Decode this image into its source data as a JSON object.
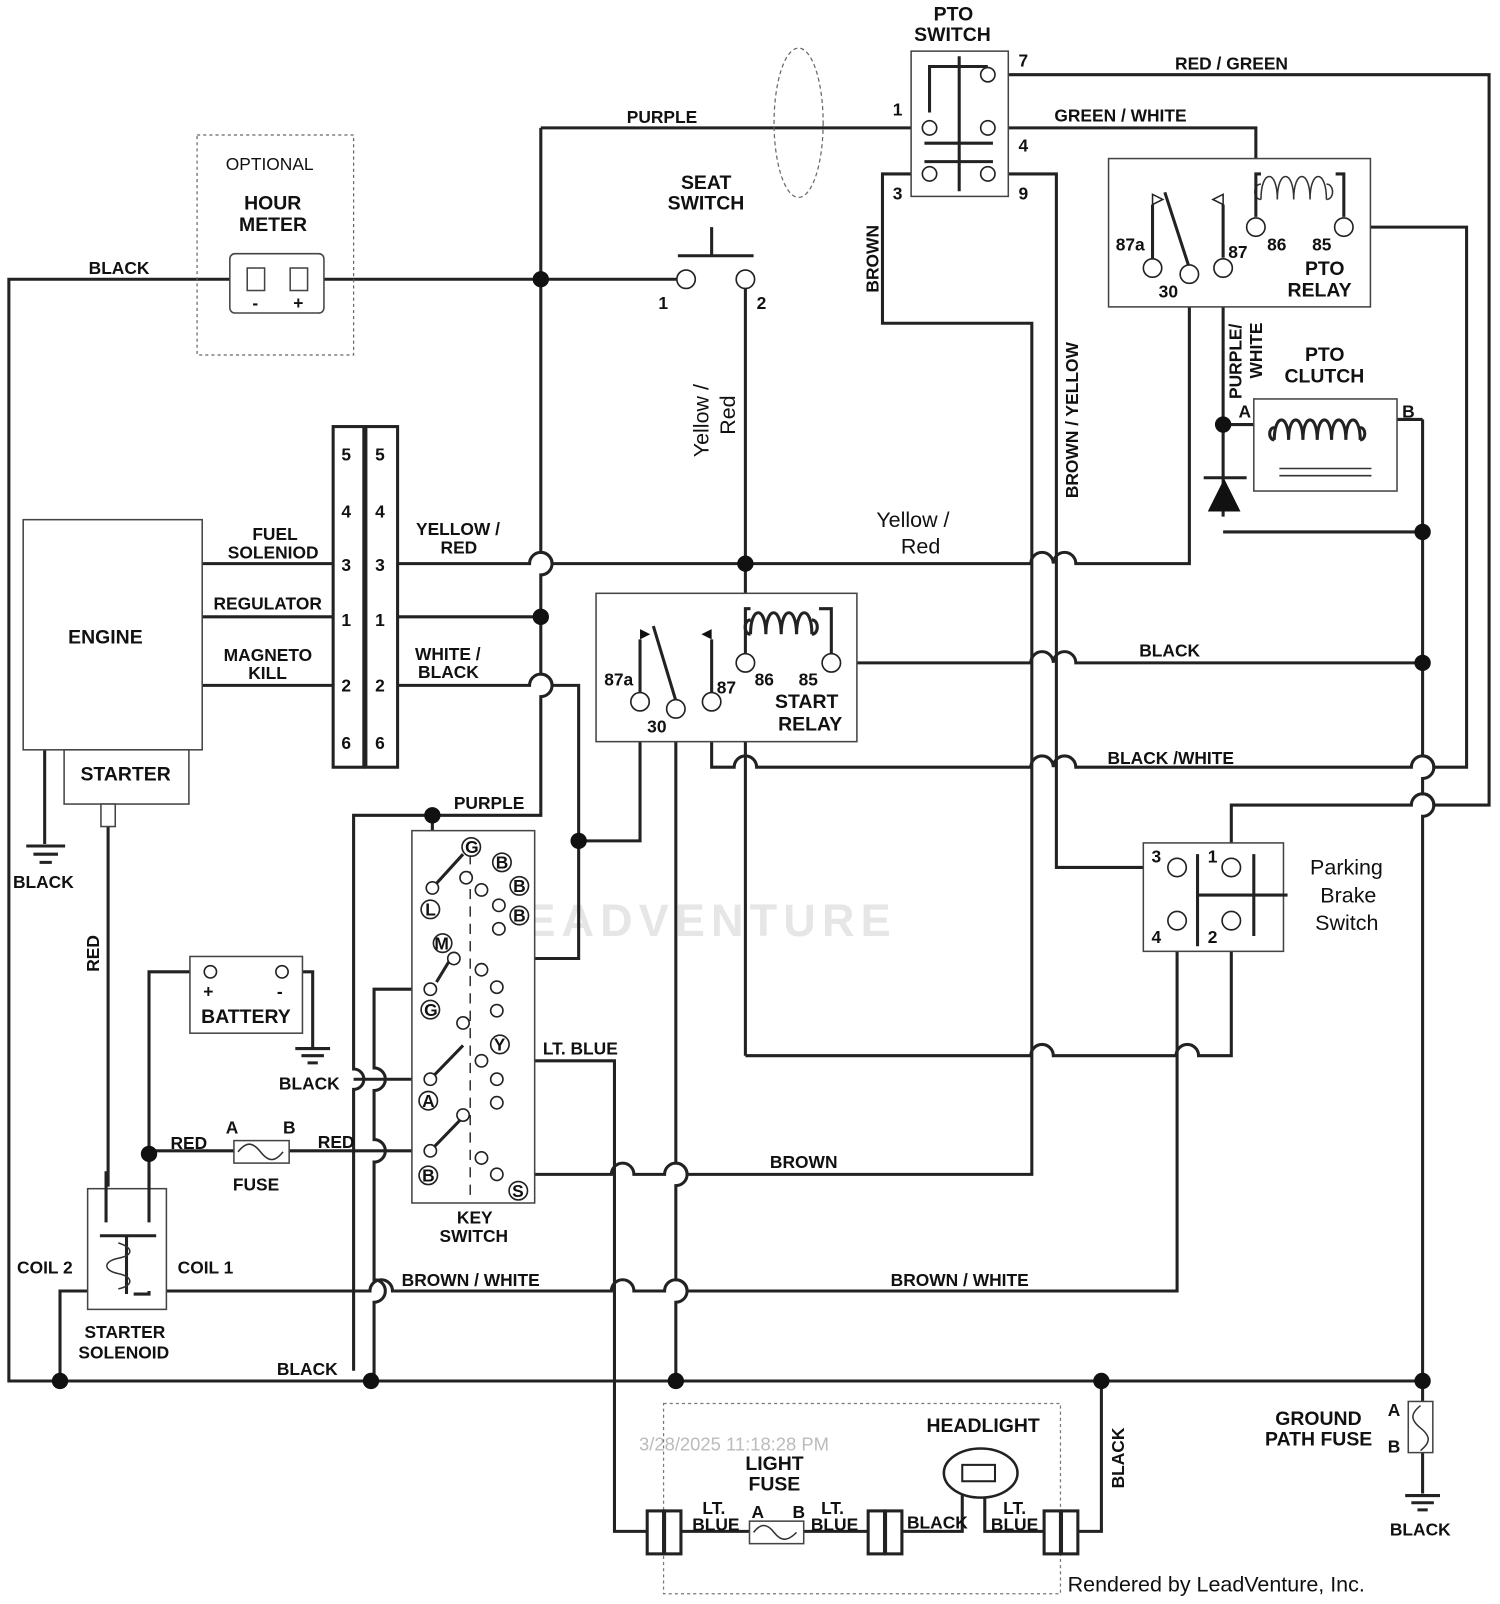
{
  "labels": {
    "pto_switch": [
      "PTO",
      "SWITCH"
    ],
    "red_green": "RED / GREEN",
    "purple_top": "PURPLE",
    "green_white": "GREEN / WHITE",
    "optional": "OPTIONAL",
    "hour_meter": [
      "HOUR",
      "METER"
    ],
    "hour_minus": "-",
    "hour_plus": "+",
    "black_top": "BLACK",
    "seat_switch": [
      "SEAT",
      "SWITCH"
    ],
    "seat_1": "1",
    "seat_2": "2",
    "brown_vert": "BROWN",
    "brown_yellow": "BROWN / YELLOW",
    "yellow_red_vert": [
      "Yellow /",
      "Red"
    ],
    "yellow_red_mid": [
      "Yellow /",
      "Red"
    ],
    "pto_pins": {
      "p1": "1",
      "p7": "7",
      "p4": "4",
      "p3": "3",
      "p9": "9"
    },
    "pto_relay": [
      "PTO",
      "RELAY"
    ],
    "relay_pins": {
      "p87a": "87a",
      "p30": "30",
      "p87": "87",
      "p86": "86",
      "p85": "85"
    },
    "purple_white": [
      "PURPLE/",
      "WHITE"
    ],
    "pto_clutch": [
      "PTO",
      "CLUTCH"
    ],
    "clutch_a": "A",
    "clutch_b": "B",
    "engine": "ENGINE",
    "starter": "STARTER",
    "fuel_solenoid": [
      "FUEL",
      "SOLENIOD"
    ],
    "regulator": "REGULATOR",
    "magneto_kill": [
      "MAGNETO",
      "KILL"
    ],
    "yellow_red_conn": [
      "YELLOW /",
      "RED"
    ],
    "white_black": [
      "WHITE /",
      "BLACK"
    ],
    "connector_pins": [
      "5",
      "4",
      "3",
      "1",
      "2",
      "6"
    ],
    "start_relay": [
      "START",
      "RELAY"
    ],
    "black_mid": "BLACK",
    "black_white": "BLACK /WHITE",
    "purple_key": "PURPLE",
    "black_ground_left": "BLACK",
    "red_vert": "RED",
    "battery": "BATTERY",
    "battery_plus": "+",
    "battery_minus": "-",
    "black_battery": "BLACK",
    "key_terminals": [
      "G",
      "B",
      "B",
      "B",
      "L",
      "M",
      "G",
      "Y",
      "A",
      "B",
      "S"
    ],
    "key_switch": [
      "KEY",
      "SWITCH"
    ],
    "lt_blue_key": "LT. BLUE",
    "red_left": "RED",
    "red_right": "RED",
    "fuse": "FUSE",
    "fuse_a": "A",
    "fuse_b": "B",
    "brown_bottom": "BROWN",
    "coil2": "COIL 2",
    "coil1": "COIL 1",
    "starter_solenoid": [
      "STARTER",
      "SOLENOID"
    ],
    "brown_white_left": "BROWN / WHITE",
    "brown_white_right": "BROWN / WHITE",
    "black_bottom": "BLACK",
    "parking_brake": [
      "Parking",
      "Brake",
      "Switch"
    ],
    "parking_pins": {
      "p3": "3",
      "p1": "1",
      "p4": "4",
      "p2": "2"
    },
    "ground_path_fuse": [
      "GROUND",
      "PATH FUSE"
    ],
    "gpf_a": "A",
    "gpf_b": "B",
    "black_gpf": "BLACK",
    "headlight": "HEADLIGHT",
    "light_fuse": [
      "LIGHT",
      "FUSE"
    ],
    "lf_a": "A",
    "lf_b": "B",
    "lt_blue_1": [
      "LT.",
      "BLUE"
    ],
    "lt_blue_2": [
      "LT.",
      "BLUE"
    ],
    "lt_blue_3": [
      "LT.",
      "BLUE"
    ],
    "black_headlight": "BLACK",
    "black_headlight_vert": "BLACK",
    "timestamp": "3/28/2025 11:18:28 PM",
    "watermark": "LEADVENTURE",
    "credit": "Rendered by LeadVenture, Inc."
  },
  "colors": {
    "wire": "#222222",
    "background": "#ffffff",
    "watermark": "#e6e6e6"
  }
}
